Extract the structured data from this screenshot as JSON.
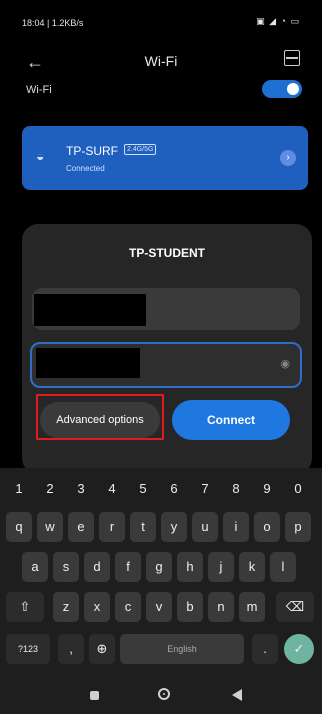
{
  "status_bar": {
    "time": "18:04 | 1.2KB/s",
    "right": "▣ ◢ ◔ ▭"
  },
  "header": {
    "back": "←",
    "title": "Wi-Fi"
  },
  "wifi_toggle": {
    "label": "Wi-Fi",
    "on": true
  },
  "connected_network": {
    "ssid": "TP-SURF",
    "band": "2.4G/5G",
    "status": "Connected",
    "chevron": "›"
  },
  "dialog": {
    "title": "TP-STUDENT",
    "field1_value": "",
    "field2_value": "",
    "advanced_label": "Advanced options",
    "connect_label": "Connect",
    "eye": "◉"
  },
  "keyboard": {
    "numbers": [
      "1",
      "2",
      "3",
      "4",
      "5",
      "6",
      "7",
      "8",
      "9",
      "0"
    ],
    "row1": [
      "q",
      "w",
      "e",
      "r",
      "t",
      "y",
      "u",
      "i",
      "o",
      "p"
    ],
    "row2": [
      "a",
      "s",
      "d",
      "f",
      "g",
      "h",
      "j",
      "k",
      "l"
    ],
    "row3": [
      "z",
      "x",
      "c",
      "v",
      "b",
      "n",
      "m"
    ],
    "shift": "⇧",
    "backspace": "⌫",
    "sym": "?123",
    "comma": ",",
    "globe": "⊕",
    "space": "English",
    "period": ".",
    "enter": "✓"
  },
  "colors": {
    "accent": "#1f78e0",
    "highlight": "#e21c1c",
    "card": "#1f5fbd"
  }
}
